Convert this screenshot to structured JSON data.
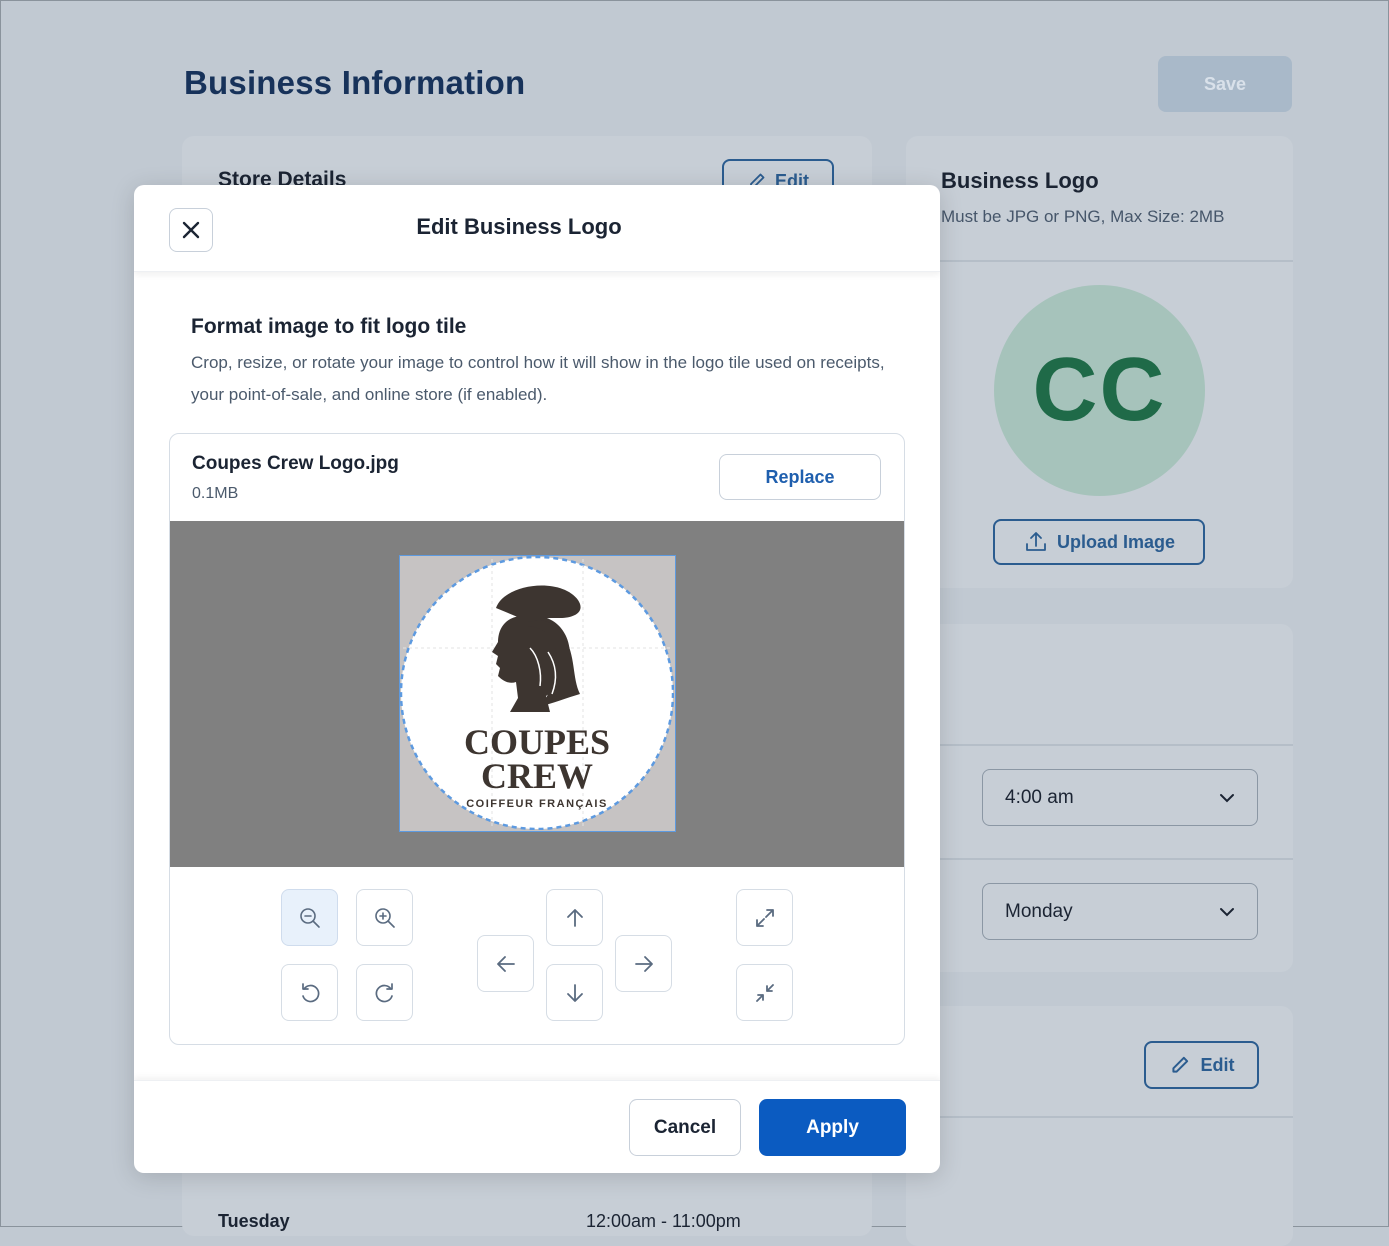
{
  "page": {
    "title": "Business Information",
    "save_label": "Save"
  },
  "store_details": {
    "title": "Store Details",
    "edit_label": "Edit"
  },
  "business_logo": {
    "title": "Business Logo",
    "subtitle": "Must be JPG or PNG, Max Size: 2MB",
    "initials": "CC",
    "upload_label": "Upload Image"
  },
  "hours": {
    "time_select": "4:00 am",
    "day_select": "Monday"
  },
  "schedule": {
    "edit_label": "Edit",
    "rows": [
      {
        "day": "Tuesday",
        "hours": "12:00am - 11:00pm"
      }
    ]
  },
  "modal": {
    "title": "Edit Business Logo",
    "section_title": "Format image to fit logo tile",
    "section_desc": "Crop, resize, or rotate your image to control how it will show in the logo tile used on receipts, your point-of-sale, and online store (if enabled).",
    "file_name": "Coupes Crew Logo.jpg",
    "file_size": "0.1MB",
    "replace_label": "Replace",
    "cancel_label": "Cancel",
    "apply_label": "Apply",
    "logo_text": {
      "line1": "COUPES",
      "line2": "CREW",
      "tagline": "COIFFEUR FRANÇAIS"
    },
    "controls": [
      "zoom-out-icon",
      "zoom-in-icon",
      "rotate-left-icon",
      "rotate-right-icon",
      "arrow-up-icon",
      "arrow-left-icon",
      "arrow-right-icon",
      "arrow-down-icon",
      "expand-icon",
      "shrink-icon"
    ]
  },
  "colors": {
    "accent": "#0b5bc1",
    "overlay": "#c1c9d2",
    "avatar_bg": "#a6c3bb",
    "avatar_text": "#1f6a48"
  }
}
